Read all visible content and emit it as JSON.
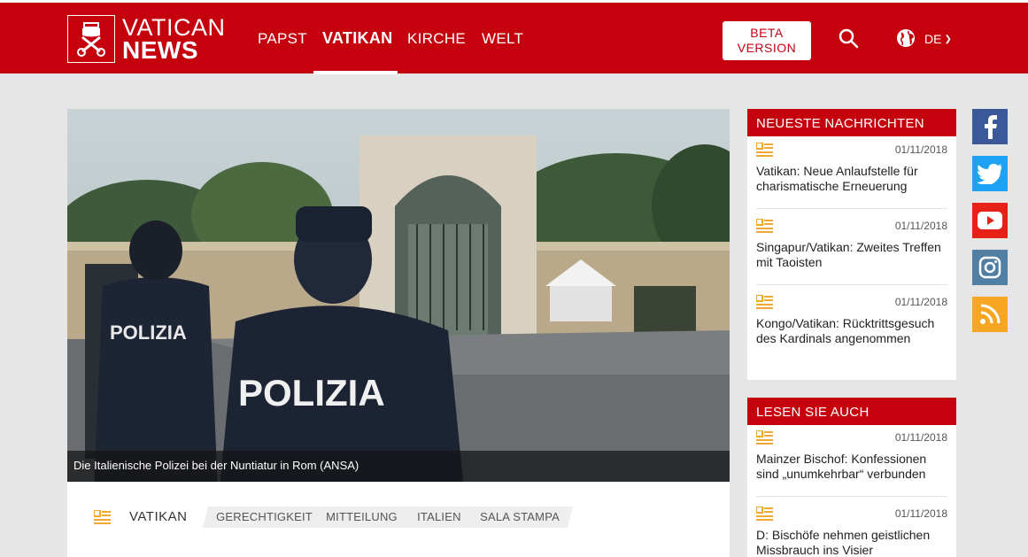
{
  "header": {
    "logo_word1": "VATICAN",
    "logo_word2": "NEWS",
    "nav": [
      {
        "label": "PAPST"
      },
      {
        "label": "VATIKAN",
        "active": true
      },
      {
        "label": "KIRCHE"
      },
      {
        "label": "WELT"
      }
    ],
    "beta_line1": "BETA",
    "beta_line2": "VERSION",
    "language": "DE",
    "icons": {
      "search": "search-icon",
      "globe": "globe-icon",
      "chevron": "chevron-down-icon"
    }
  },
  "article": {
    "caption": "Die Italienische Polizei bei der Nuntiatur in Rom  (ANSA)",
    "category": "VATIKAN",
    "tags": [
      "GERECHTIGKEIT",
      "MITTEILUNG",
      "ITALIEN",
      "SALA STAMPA"
    ]
  },
  "latest": {
    "heading": "NEUESTE NACHRICHTEN",
    "items": [
      {
        "date": "01/11/2018",
        "title": "Vatikan: Neue Anlaufstelle für charismatische Erneuerung"
      },
      {
        "date": "01/11/2018",
        "title": "Singapur/Vatikan: Zweites Treffen mit Taoisten"
      },
      {
        "date": "01/11/2018",
        "title": "Kongo/Vatikan: Rücktrittsgesuch des Kardinals angenommen"
      }
    ]
  },
  "read_also": {
    "heading": "LESEN SIE AUCH",
    "items": [
      {
        "date": "01/11/2018",
        "title": "Mainzer Bischof: Konfessionen sind „unumkehrbar“ verbunden"
      },
      {
        "date": "01/11/2018",
        "title": "D: Bischöfe nehmen geistlichen Missbrauch ins Visier"
      }
    ]
  },
  "social": [
    {
      "name": "facebook-icon",
      "color": "#3b5998"
    },
    {
      "name": "twitter-icon",
      "color": "#1da1f2"
    },
    {
      "name": "youtube-icon",
      "color": "#e62117"
    },
    {
      "name": "instagram-icon",
      "color": "#517fa4"
    },
    {
      "name": "rss-icon",
      "color": "#f6a623"
    }
  ],
  "colors": {
    "brand_red": "#c5010e",
    "accent_gold": "#f0a830",
    "background": "#e6e6e6"
  }
}
